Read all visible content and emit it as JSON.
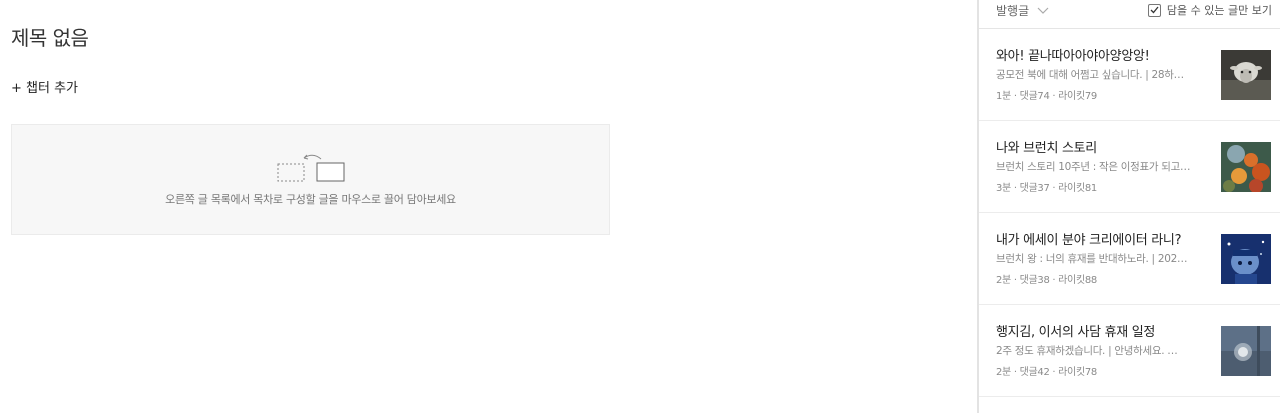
{
  "editor": {
    "title": "제목 없음",
    "add_chapter": "+ 챕터 추가",
    "dropzone_hint": "오른쪽 글 목록에서 목차로 구성할 글을 마우스로 끌어 담아보세요"
  },
  "panel": {
    "sort": {
      "selected": "발행글",
      "icon": "chevron-down-icon"
    },
    "filter": {
      "label": "담을 수 있는 글만 보기",
      "checked": true
    },
    "posts": [
      {
        "title": "와아! 끝나따아아야아양앙앙!",
        "excerpt": "공모전 북에 대해 어쩜고 싶습니다. | 28하…",
        "meta": "1분 · 댓글74 · 라이킷79",
        "thumb": "sheep-photo"
      },
      {
        "title": "나와 브런치 스토리",
        "excerpt": "브런치 스토리 10주년 : 작은 이정표가 되고…",
        "meta": "3분 · 댓글37 · 라이킷81",
        "thumb": "autumn-leaves-photo"
      },
      {
        "title": "내가 에세이 분야 크리에이터 라니?",
        "excerpt": "브런치 왕 : 너의 휴재를 반대하노라. | 202…",
        "meta": "2분 · 댓글38 · 라이킷88",
        "thumb": "illustration-character"
      },
      {
        "title": "행지김, 이서의 사담 휴재 일정",
        "excerpt": "2주 정도 휴재하겠습니다. | 안녕하세요. …",
        "meta": "2분 · 댓글42 · 라이킷78",
        "thumb": "moon-photo"
      }
    ]
  }
}
